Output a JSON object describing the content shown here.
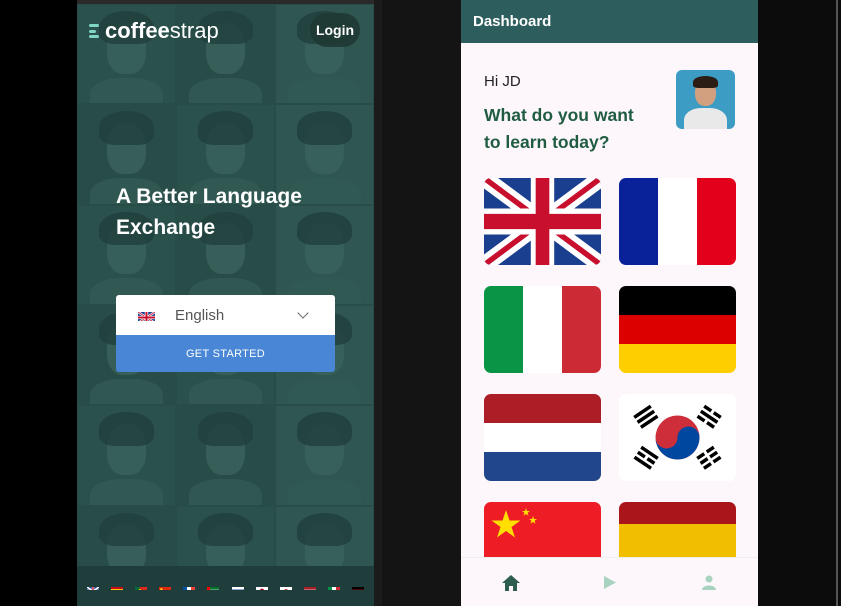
{
  "left_app": {
    "logo_bold": "coffee",
    "logo_light": "strap",
    "login_label": "Login",
    "hero_title": "A Better Language Exchange",
    "language_select": {
      "selected": "English",
      "flag": "uk-flag-icon"
    },
    "get_started_label": "GET STARTED",
    "flag_bar": [
      "uk-flag-icon",
      "spain-flag-icon",
      "portugal-flag-icon",
      "china-flag-icon",
      "france-flag-icon",
      "uae-flag-icon",
      "russia-flag-icon",
      "japan-flag-icon",
      "korea-flag-icon",
      "netherlands-flag-icon",
      "italy-flag-icon",
      "germany-flag-icon"
    ],
    "colors": {
      "background": "#2b4e4a",
      "accent_button": "#4a86d6",
      "logo_icon": "#7fd6c4"
    }
  },
  "right_app": {
    "header_title": "Dashboard",
    "greeting": "Hi JD",
    "question": "What do you want to learn today?",
    "avatar": "user-avatar",
    "languages": [
      "uk-flag-icon",
      "france-flag-icon",
      "italy-flag-icon",
      "germany-flag-icon",
      "netherlands-flag-icon",
      "korea-flag-icon",
      "china-flag-icon",
      "spain-flag-icon"
    ],
    "bottom_nav": [
      "home-icon",
      "play-icon",
      "profile-icon"
    ],
    "colors": {
      "header": "#2d5d5d",
      "question_text": "#1f5c42",
      "nav_active": "#2d5d4f",
      "nav_inactive": "#a8d3c0"
    }
  }
}
